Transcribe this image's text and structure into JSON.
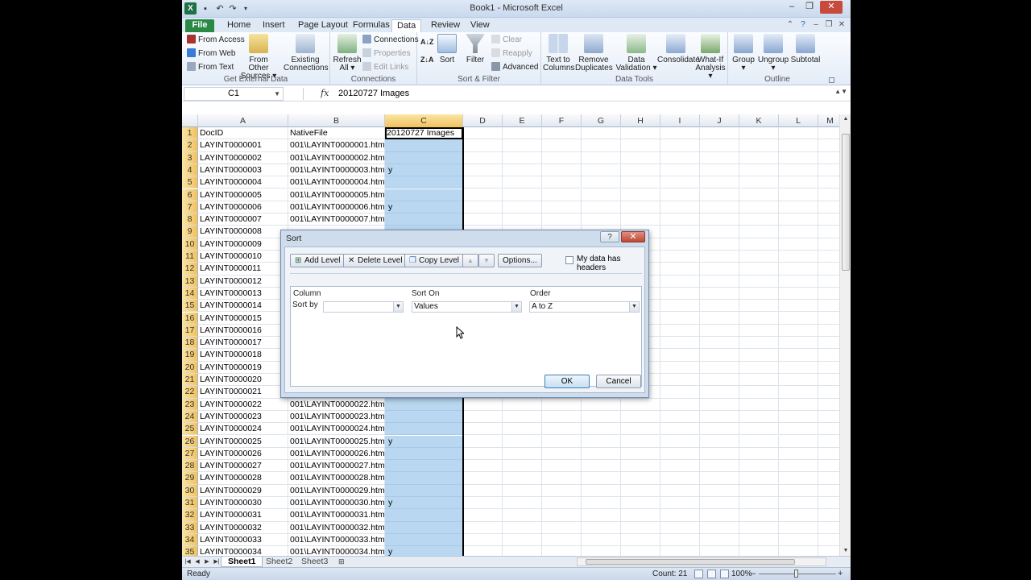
{
  "window": {
    "title": "Book1 - Microsoft Excel",
    "app_icon": "X"
  },
  "tabs": [
    "File",
    "Home",
    "Insert",
    "Page Layout",
    "Formulas",
    "Data",
    "Review",
    "View"
  ],
  "active_tab": "Data",
  "ribbon": {
    "get_external_data": {
      "label": "Get External Data",
      "from_access": "From Access",
      "from_web": "From Web",
      "from_text": "From Text",
      "from_other_sources": "From Other Sources ▾",
      "existing_connections": "Existing Connections"
    },
    "connections": {
      "label": "Connections",
      "refresh_all": "Refresh All ▾",
      "connections": "Connections",
      "properties": "Properties",
      "edit_links": "Edit Links"
    },
    "sort_filter": {
      "label": "Sort & Filter",
      "sort_az": "A↓Z",
      "sort_za": "Z↓A",
      "sort": "Sort",
      "filter": "Filter",
      "clear": "Clear",
      "reapply": "Reapply",
      "advanced": "Advanced"
    },
    "data_tools": {
      "label": "Data Tools",
      "text_to_columns": "Text to Columns",
      "remove_duplicates": "Remove Duplicates",
      "data_validation": "Data Validation ▾",
      "consolidate": "Consolidate",
      "what_if": "What-If Analysis ▾"
    },
    "outline": {
      "label": "Outline",
      "group": "Group ▾",
      "ungroup": "Ungroup ▾",
      "subtotal": "Subtotal"
    }
  },
  "formula_bar": {
    "name_box": "C1",
    "fx": "fx",
    "value": "20120727 Images"
  },
  "columns": [
    "A",
    "B",
    "C",
    "D",
    "E",
    "F",
    "G",
    "H",
    "I",
    "J",
    "K",
    "L",
    "M"
  ],
  "rows": [
    {
      "n": "1",
      "a": "DocID",
      "b": "NativeFile",
      "c": "20120727 Images"
    },
    {
      "n": "2",
      "a": "LAYINT0000001",
      "b": "001\\LAYINT0000001.htm",
      "c": ""
    },
    {
      "n": "3",
      "a": "LAYINT0000002",
      "b": "001\\LAYINT0000002.htm",
      "c": ""
    },
    {
      "n": "4",
      "a": "LAYINT0000003",
      "b": "001\\LAYINT0000003.htm",
      "c": "y"
    },
    {
      "n": "5",
      "a": "LAYINT0000004",
      "b": "001\\LAYINT0000004.htm",
      "c": ""
    },
    {
      "n": "6",
      "a": "LAYINT0000005",
      "b": "001\\LAYINT0000005.htm",
      "c": ""
    },
    {
      "n": "7",
      "a": "LAYINT0000006",
      "b": "001\\LAYINT0000006.htm",
      "c": "y"
    },
    {
      "n": "8",
      "a": "LAYINT0000007",
      "b": "001\\LAYINT0000007.htm",
      "c": ""
    },
    {
      "n": "9",
      "a": "LAYINT0000008",
      "b": "",
      "c": ""
    },
    {
      "n": "10",
      "a": "LAYINT0000009",
      "b": "",
      "c": ""
    },
    {
      "n": "11",
      "a": "LAYINT0000010",
      "b": "",
      "c": ""
    },
    {
      "n": "12",
      "a": "LAYINT0000011",
      "b": "",
      "c": ""
    },
    {
      "n": "13",
      "a": "LAYINT0000012",
      "b": "",
      "c": ""
    },
    {
      "n": "14",
      "a": "LAYINT0000013",
      "b": "",
      "c": ""
    },
    {
      "n": "15",
      "a": "LAYINT0000014",
      "b": "",
      "c": ""
    },
    {
      "n": "16",
      "a": "LAYINT0000015",
      "b": "",
      "c": ""
    },
    {
      "n": "17",
      "a": "LAYINT0000016",
      "b": "",
      "c": ""
    },
    {
      "n": "18",
      "a": "LAYINT0000017",
      "b": "",
      "c": ""
    },
    {
      "n": "19",
      "a": "LAYINT0000018",
      "b": "",
      "c": ""
    },
    {
      "n": "20",
      "a": "LAYINT0000019",
      "b": "",
      "c": ""
    },
    {
      "n": "21",
      "a": "LAYINT0000020",
      "b": "",
      "c": ""
    },
    {
      "n": "22",
      "a": "LAYINT0000021",
      "b": "",
      "c": ""
    },
    {
      "n": "23",
      "a": "LAYINT0000022",
      "b": "001\\LAYINT0000022.htm",
      "c": ""
    },
    {
      "n": "24",
      "a": "LAYINT0000023",
      "b": "001\\LAYINT0000023.htm",
      "c": ""
    },
    {
      "n": "25",
      "a": "LAYINT0000024",
      "b": "001\\LAYINT0000024.htm",
      "c": ""
    },
    {
      "n": "26",
      "a": "LAYINT0000025",
      "b": "001\\LAYINT0000025.htm",
      "c": "y"
    },
    {
      "n": "27",
      "a": "LAYINT0000026",
      "b": "001\\LAYINT0000026.htm",
      "c": ""
    },
    {
      "n": "28",
      "a": "LAYINT0000027",
      "b": "001\\LAYINT0000027.htm",
      "c": ""
    },
    {
      "n": "29",
      "a": "LAYINT0000028",
      "b": "001\\LAYINT0000028.htm",
      "c": ""
    },
    {
      "n": "30",
      "a": "LAYINT0000029",
      "b": "001\\LAYINT0000029.htm",
      "c": ""
    },
    {
      "n": "31",
      "a": "LAYINT0000030",
      "b": "001\\LAYINT0000030.htm",
      "c": "y"
    },
    {
      "n": "32",
      "a": "LAYINT0000031",
      "b": "001\\LAYINT0000031.htm",
      "c": ""
    },
    {
      "n": "33",
      "a": "LAYINT0000032",
      "b": "001\\LAYINT0000032.htm",
      "c": ""
    },
    {
      "n": "34",
      "a": "LAYINT0000033",
      "b": "001\\LAYINT0000033.htm",
      "c": ""
    },
    {
      "n": "35",
      "a": "LAYINT0000034",
      "b": "001\\LAYINT0000034.htm",
      "c": "y"
    }
  ],
  "sheets": [
    "Sheet1",
    "Sheet2",
    "Sheet3"
  ],
  "active_sheet": "Sheet1",
  "status": {
    "ready": "Ready",
    "count": "Count: 21",
    "zoom": "100%"
  },
  "dialog": {
    "title": "Sort",
    "help": "?",
    "close": "✕",
    "add_level": "Add Level",
    "delete_level": "Delete Level",
    "copy_level": "Copy Level",
    "move_up": "▲",
    "move_down": "▼",
    "options": "Options...",
    "my_data_has_headers": "My data has headers",
    "col_header": "Column",
    "sort_on_header": "Sort On",
    "order_header": "Order",
    "sort_by": "Sort by",
    "sort_by_value": "",
    "sort_on_value": "Values",
    "order_value": "A to Z",
    "ok": "OK",
    "cancel": "Cancel"
  },
  "colors": {
    "selection": "#b9d7f0",
    "header_highlight": "#f1c15f",
    "file_tab": "#2a8a45"
  }
}
